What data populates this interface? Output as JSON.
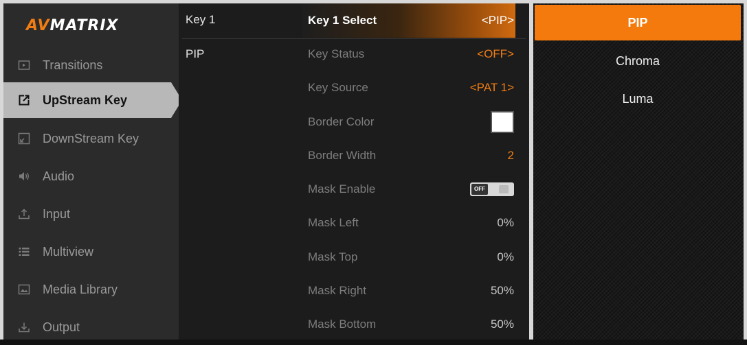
{
  "logo": {
    "part1": "AV",
    "part2": "MATRIX"
  },
  "sidebar": {
    "items": [
      {
        "label": "Transitions",
        "icon": "transitions-icon"
      },
      {
        "label": "UpStream Key",
        "icon": "upstream-key-icon",
        "active": true
      },
      {
        "label": "DownStream Key",
        "icon": "downstream-key-icon"
      },
      {
        "label": "Audio",
        "icon": "audio-icon"
      },
      {
        "label": "Input",
        "icon": "input-icon"
      },
      {
        "label": "Multiview",
        "icon": "multiview-icon"
      },
      {
        "label": "Media Library",
        "icon": "media-library-icon"
      },
      {
        "label": "Output",
        "icon": "output-icon"
      }
    ]
  },
  "keys": [
    "Key 1",
    "PIP"
  ],
  "params": [
    {
      "label": "Key 1 Select",
      "value": "<PIP>"
    },
    {
      "label": "Key Status",
      "value": "<OFF>"
    },
    {
      "label": "Key Source",
      "value": "<PAT 1>"
    },
    {
      "label": "Border Color",
      "value": ""
    },
    {
      "label": "Border Width",
      "value": "2"
    },
    {
      "label": "Mask Enable",
      "value": "OFF"
    },
    {
      "label": "Mask Left",
      "value": "0%"
    },
    {
      "label": "Mask Top",
      "value": "0%"
    },
    {
      "label": "Mask Right",
      "value": "50%"
    },
    {
      "label": "Mask Bottom",
      "value": "50%"
    }
  ],
  "options": [
    {
      "label": "PIP",
      "active": true
    },
    {
      "label": "Chroma"
    },
    {
      "label": "Luma"
    }
  ],
  "colors": {
    "accent": "#f47a0e",
    "border_color_value": "#ffffff"
  }
}
